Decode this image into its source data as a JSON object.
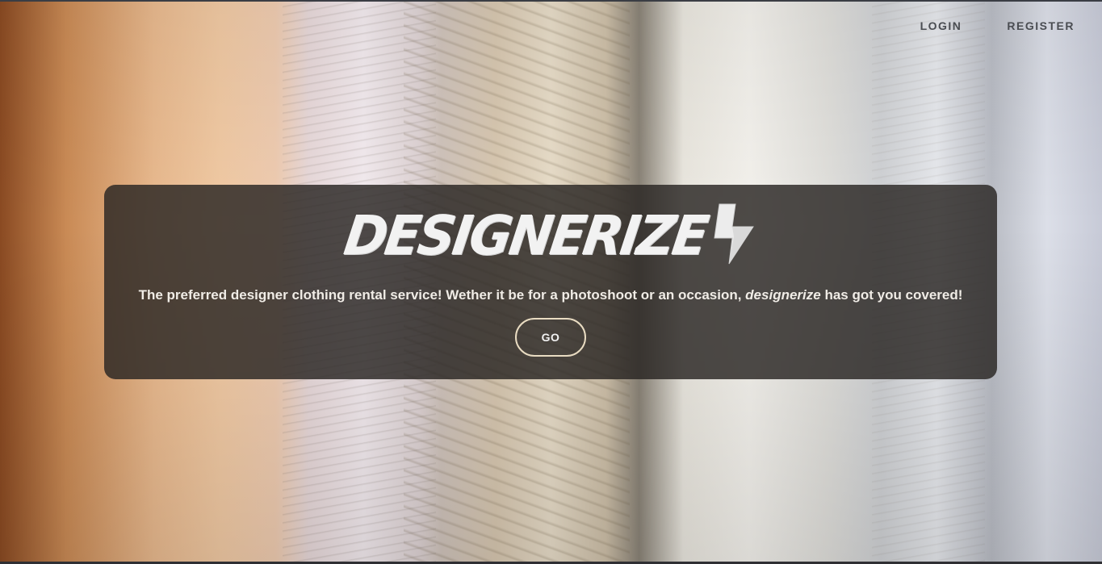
{
  "nav": {
    "login_label": "LOGIN",
    "register_label": "REGISTER"
  },
  "hero": {
    "logo_text": "DESIGNERIZE",
    "logo_icon": "lightning-bolt-icon",
    "tagline_before": "The preferred designer clothing rental service! Wether it be for a photoshoot or an occasion, ",
    "tagline_emphasis": "designerize",
    "tagline_after": " has got you covered!",
    "go_label": "GO"
  },
  "colors": {
    "panel": "#282422",
    "go_border": "#e9dcc2",
    "nav_text": "#4a4d52"
  }
}
